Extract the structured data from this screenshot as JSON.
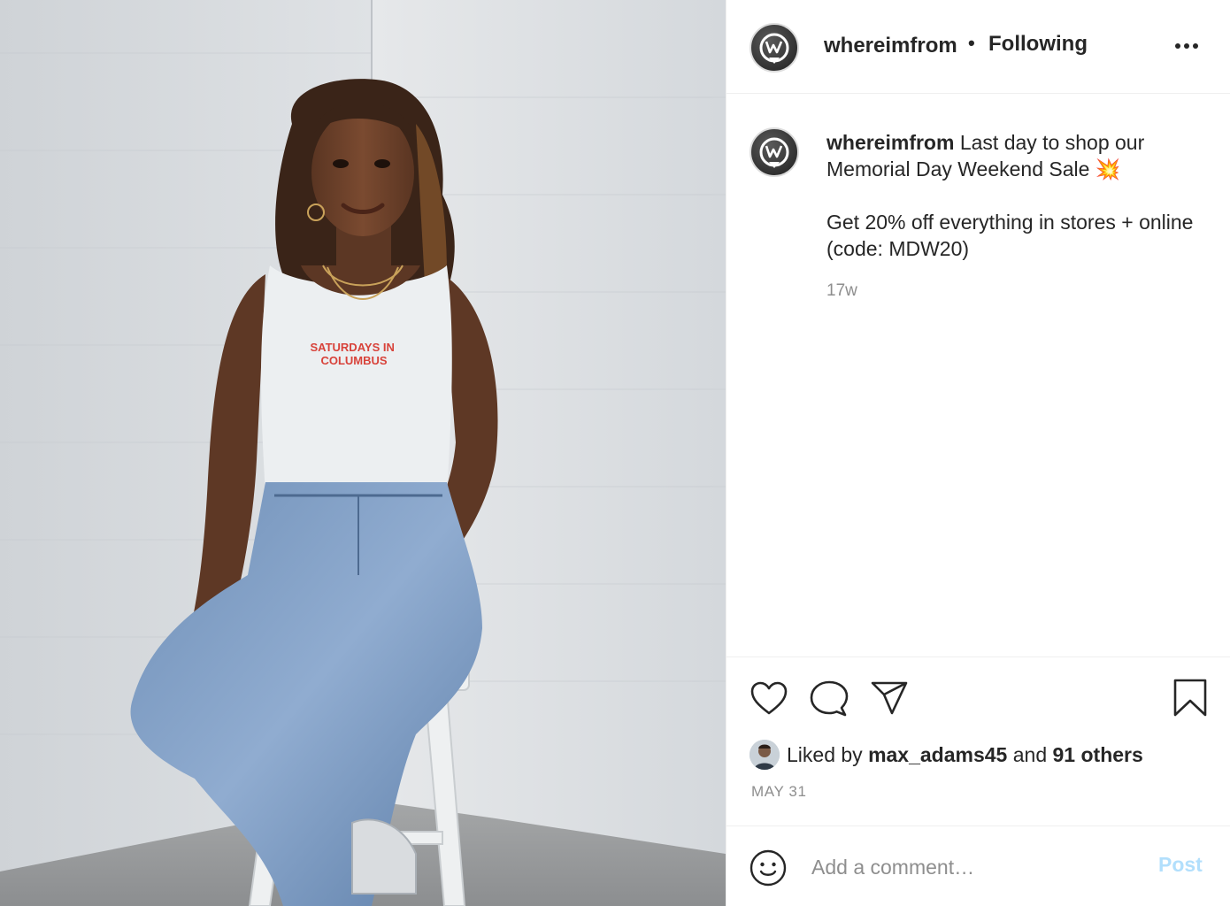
{
  "post": {
    "image_text": "SATURDAYS IN COLUMBUS"
  },
  "header": {
    "username": "whereimfrom",
    "separator": "•",
    "follow_status": "Following",
    "more_icon": "more-horizontal-icon"
  },
  "caption": {
    "username": "whereimfrom",
    "line1": " Last day to shop our Memorial Day Weekend Sale 💥",
    "line2": "Get 20% off everything in stores + online (code: MDW20)",
    "time": "17w"
  },
  "actions": {
    "like_icon": "heart-icon",
    "comment_icon": "comment-icon",
    "share_icon": "share-icon",
    "save_icon": "bookmark-icon"
  },
  "likes": {
    "prefix": "Liked by",
    "user": "max_adams45",
    "middle": "and",
    "others": "91 others"
  },
  "post_date": "MAY 31",
  "comment": {
    "placeholder": "Add a comment…",
    "post_label": "Post",
    "post_color": "#b2dffc"
  }
}
